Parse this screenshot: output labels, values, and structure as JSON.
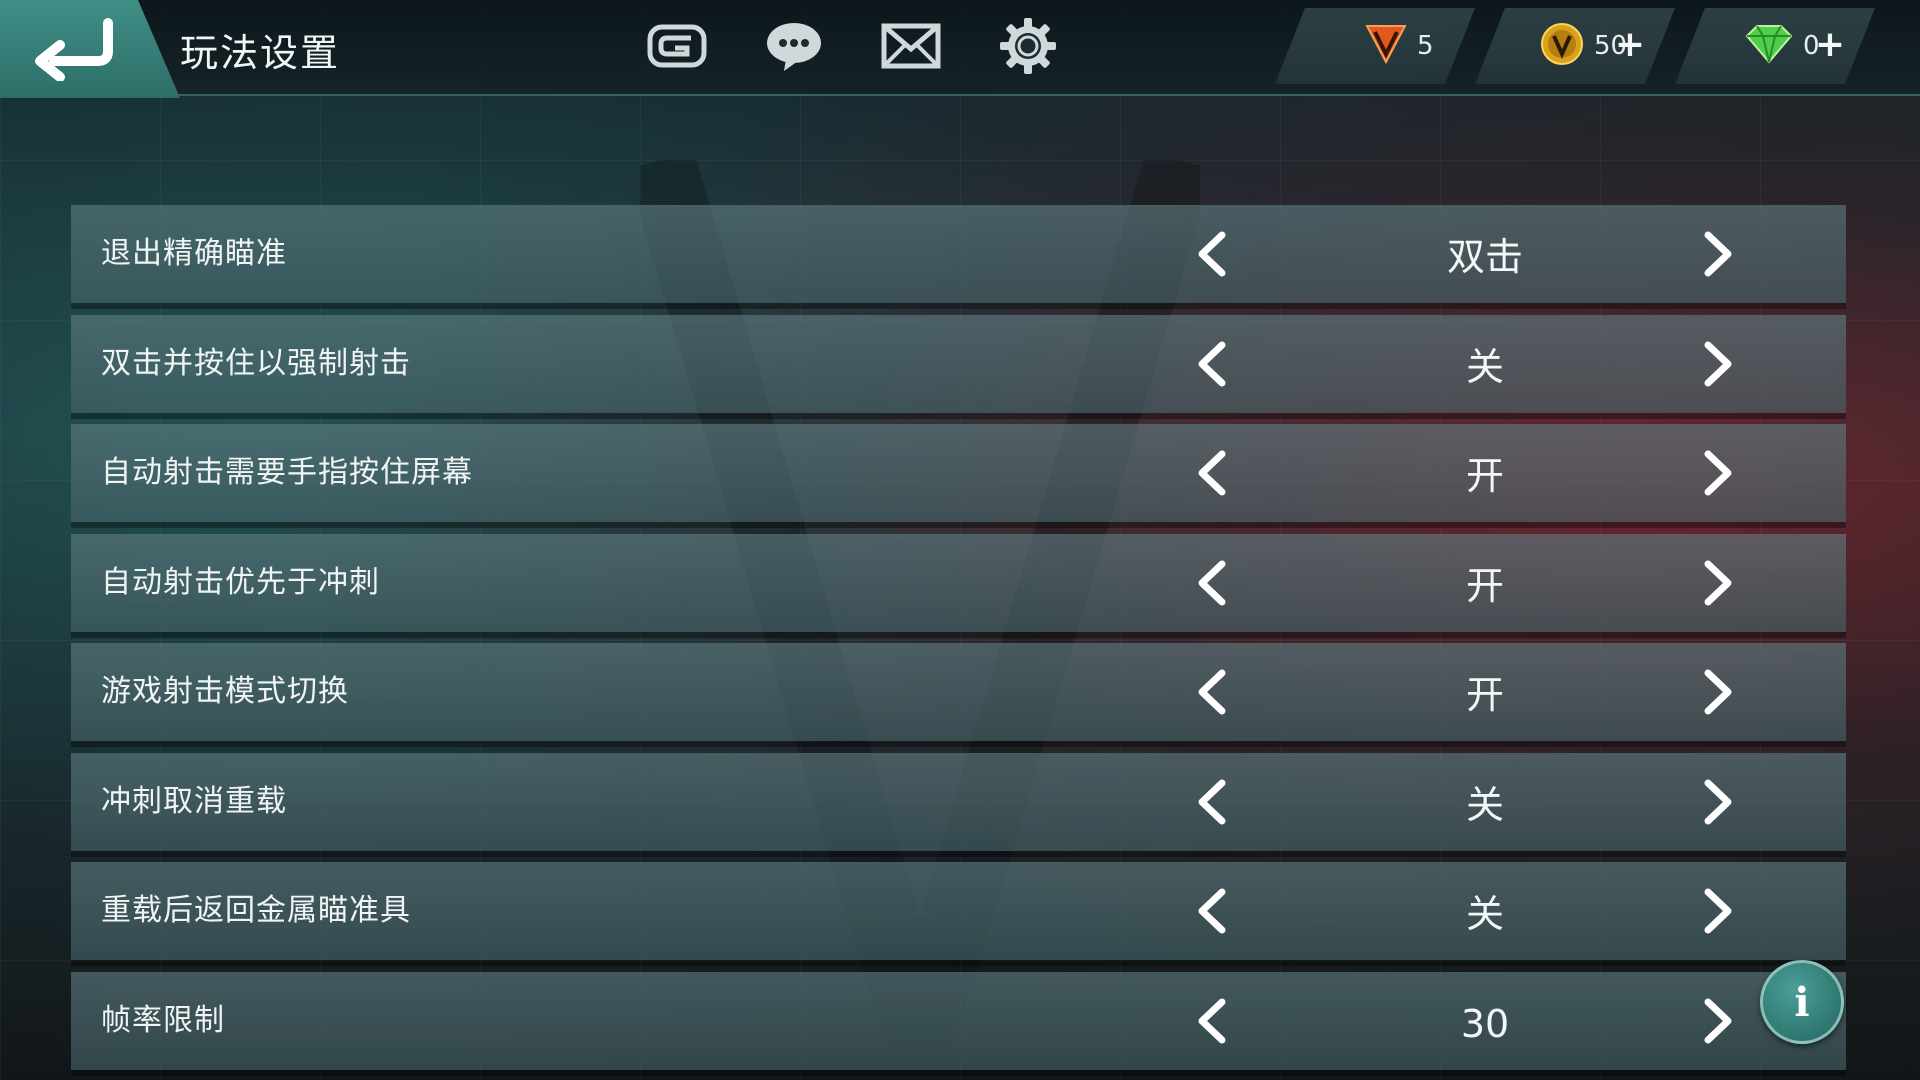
{
  "header": {
    "title": "玩法设置",
    "icons": [
      "gameloft-icon",
      "chat-icon",
      "mail-icon",
      "gear-icon"
    ]
  },
  "currencies": [
    {
      "name": "v-token",
      "value": "5",
      "color": "#e05a20",
      "has_plus": false
    },
    {
      "name": "gold-coin",
      "value": "50",
      "color": "#d9a21a",
      "has_plus": true
    },
    {
      "name": "diamond",
      "value": "0",
      "color": "#4fcf4a",
      "has_plus": true
    }
  ],
  "plus_label": "+",
  "settings": [
    {
      "label": "退出精确瞄准",
      "value": "双击"
    },
    {
      "label": "双击并按住以强制射击",
      "value": "关"
    },
    {
      "label": "自动射击需要手指按住屏幕",
      "value": "开"
    },
    {
      "label": "自动射击优先于冲刺",
      "value": "开"
    },
    {
      "label": "游戏射击模式切换",
      "value": "开"
    },
    {
      "label": "冲刺取消重载",
      "value": "关"
    },
    {
      "label": "重载后返回金属瞄准具",
      "value": "关"
    },
    {
      "label": "帧率限制",
      "value": "30"
    }
  ],
  "info_label": "i",
  "colors": {
    "accent": "#3f8f86",
    "row_bg": "#5f7d82",
    "text": "#f0f4f4"
  }
}
